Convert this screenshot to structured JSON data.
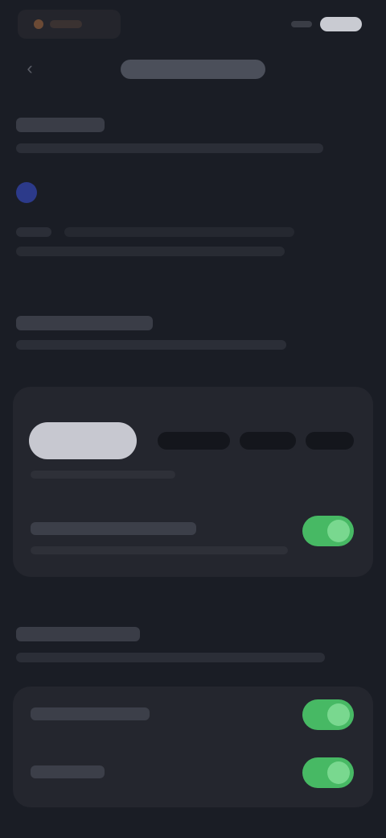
{
  "status_bar": {
    "left_icons": [
      "app-icon",
      "notification-icon"
    ],
    "right_icons": [
      "signal-icon",
      "battery-icon"
    ]
  },
  "header": {
    "back_icon": "back-icon",
    "title": ""
  },
  "section_1": {
    "title": "",
    "description": "",
    "accent_color": "#2c3a8a",
    "note": ""
  },
  "section_2": {
    "title": "",
    "description": "",
    "primary_button_label": "",
    "primary_button_sub": "",
    "toggle_row": {
      "label": "",
      "sub": "",
      "enabled": true
    }
  },
  "section_3": {
    "title": "",
    "description": "",
    "rows": [
      {
        "label": "",
        "enabled": true
      },
      {
        "label": "",
        "enabled": true
      }
    ]
  },
  "colors": {
    "background": "#1a1d25",
    "card": "#24262e",
    "toggle_on": "#47b964",
    "toggle_knob": "#79d88f",
    "primary_button": "#c7c8d0"
  }
}
